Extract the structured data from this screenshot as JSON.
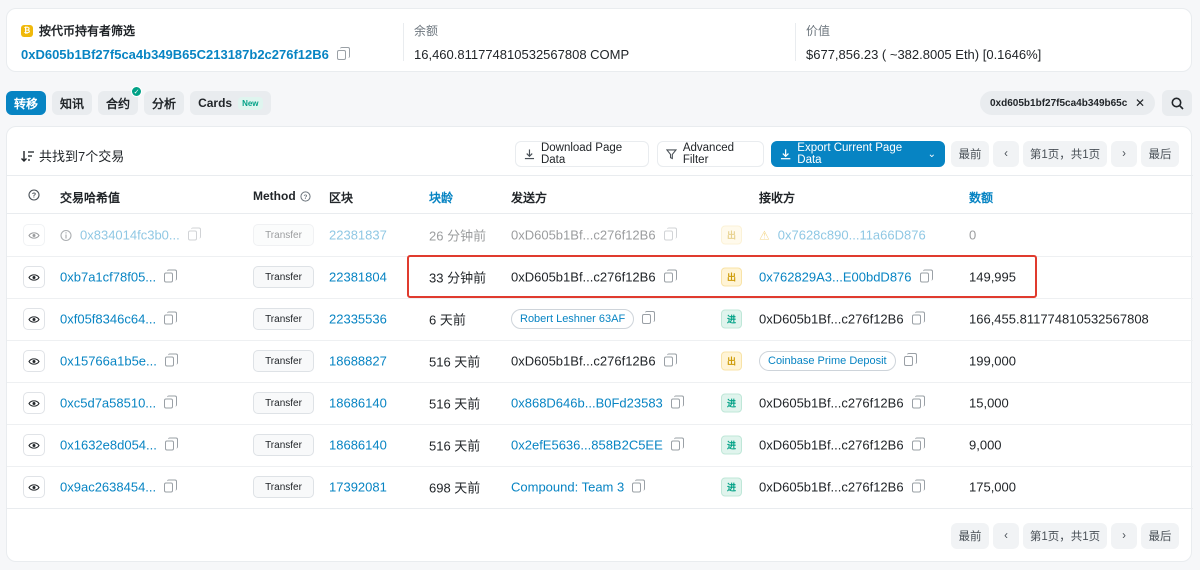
{
  "top": {
    "filter_label": "按代币持有者筛选",
    "address": "0xD605b1Bf27f5ca4b349B65C213187b2c276f12B6",
    "balance_label": "余额",
    "balance_value": "16,460.811774810532567808 COMP",
    "value_label": "价值",
    "value_value": "$677,856.23 ( ~382.8005 Eth) [0.1646%]"
  },
  "tabs": [
    {
      "label": "转移",
      "active": true
    },
    {
      "label": "知讯"
    },
    {
      "label": "合约",
      "verified": true
    },
    {
      "label": "分析"
    },
    {
      "label": "Cards",
      "badge": "New"
    }
  ],
  "filter_pill": "0xd605b1bf27f5ca4b349b65c...",
  "toolbar": {
    "found": "共找到7个交易",
    "download": "Download Page Data",
    "advanced": "Advanced Filter",
    "export": "Export Current Page Data"
  },
  "pager": {
    "first": "最前",
    "page": "第1页，共1页",
    "last": "最后"
  },
  "columns": {
    "hash": "交易哈希值",
    "method": "Method",
    "block": "区块",
    "age": "块龄",
    "from": "发送方",
    "to": "接收方",
    "amount": "数额"
  },
  "rows": [
    {
      "hash": "0x834014fc3b0...",
      "method": "Transfer",
      "block": "22381837",
      "age": "26 分钟前",
      "from": "0xD605b1Bf...c276f12B6",
      "dir": "出",
      "to": "0x7628c890...11a66D876",
      "amount": "0",
      "faded": true
    },
    {
      "hash": "0xb7a1cf78f05...",
      "method": "Transfer",
      "block": "22381804",
      "age": "33 分钟前",
      "from": "0xD605b1Bf...c276f12B6",
      "dir": "出",
      "to": "0x762829A3...E00bdD876",
      "amount": "149,995"
    },
    {
      "hash": "0xf05f8346c64...",
      "method": "Transfer",
      "block": "22335536",
      "age": "6 天前",
      "from": "Robert Leshner 63AF",
      "dir": "进",
      "to": "0xD605b1Bf...c276f12B6",
      "amount": "166,455.811774810532567808"
    },
    {
      "hash": "0x15766a1b5e...",
      "method": "Transfer",
      "block": "18688827",
      "age": "516 天前",
      "from": "0xD605b1Bf...c276f12B6",
      "dir": "出",
      "to": "Coinbase Prime Deposit",
      "amount": "199,000"
    },
    {
      "hash": "0xc5d7a58510...",
      "method": "Transfer",
      "block": "18686140",
      "age": "516 天前",
      "from": "0x868D646b...B0Fd23583",
      "dir": "进",
      "to": "0xD605b1Bf...c276f12B6",
      "amount": "15,000"
    },
    {
      "hash": "0x1632e8d054...",
      "method": "Transfer",
      "block": "18686140",
      "age": "516 天前",
      "from": "0x2efE5636...858B2C5EE",
      "dir": "进",
      "to": "0xD605b1Bf...c276f12B6",
      "amount": "9,000"
    },
    {
      "hash": "0x9ac2638454...",
      "method": "Transfer",
      "block": "17392081",
      "age": "698 天前",
      "from": "Compound: Team 3",
      "dir": "进",
      "to": "0xD605b1Bf...c276f12B6",
      "amount": "175,000"
    }
  ],
  "colors": {
    "accent": "#0784c3",
    "highlight": "#e03b2e",
    "in": "#00a186",
    "out": "#cc9a06"
  }
}
